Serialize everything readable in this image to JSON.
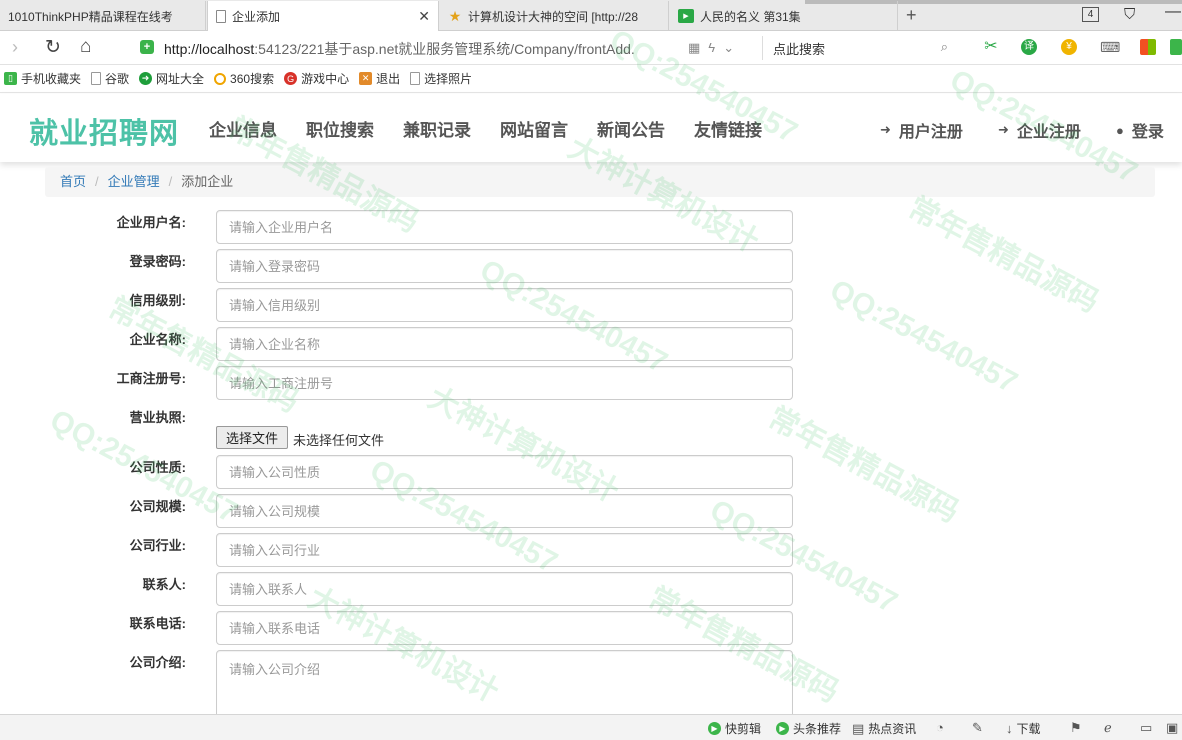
{
  "browser": {
    "tabs": [
      {
        "title": "1010ThinkPHP精品课程在线考",
        "icon": "page-icon"
      },
      {
        "title": "企业添加",
        "icon": "page-icon",
        "active": true
      },
      {
        "title": "计算机设计大神的空间 [http://28",
        "icon": "star-icon"
      },
      {
        "title": "人民的名义 第31集",
        "icon": "video-icon"
      }
    ],
    "tab_count": "4",
    "url_host": "http://localhost",
    "url_path": ":54123/221基于asp.net就业服务管理系统/Company/frontAdd.",
    "search_label": "点此搜索",
    "bookmarks": [
      "手机收藏夹",
      "谷歌",
      "网址大全",
      "360搜索",
      "游戏中心",
      "退出",
      "选择照片"
    ]
  },
  "site": {
    "logo": "就业招聘网",
    "nav": [
      "企业信息",
      "职位搜索",
      "兼职记录",
      "网站留言",
      "新闻公告",
      "友情链接"
    ],
    "user_register": "用户注册",
    "company_register": "企业注册",
    "login": "登录"
  },
  "breadcrumb": {
    "home": "首页",
    "section": "企业管理",
    "current": "添加企业"
  },
  "form": {
    "fields": [
      {
        "label": "企业用户名:",
        "placeholder": "请输入企业用户名"
      },
      {
        "label": "登录密码:",
        "placeholder": "请输入登录密码"
      },
      {
        "label": "信用级别:",
        "placeholder": "请输入信用级别"
      },
      {
        "label": "企业名称:",
        "placeholder": "请输入企业名称"
      },
      {
        "label": "工商注册号:",
        "placeholder": "请输入工商注册号"
      }
    ],
    "license_label": "营业执照:",
    "file_button": "选择文件",
    "file_status": "未选择任何文件",
    "fields2": [
      {
        "label": "公司性质:",
        "placeholder": "请输入公司性质"
      },
      {
        "label": "公司规模:",
        "placeholder": "请输入公司规模"
      },
      {
        "label": "公司行业:",
        "placeholder": "请输入公司行业"
      },
      {
        "label": "联系人:",
        "placeholder": "请输入联系人"
      },
      {
        "label": "联系电话:",
        "placeholder": "请输入联系电话"
      }
    ],
    "intro_label": "公司介绍:",
    "intro_placeholder": "请输入公司介绍"
  },
  "statusbar": {
    "items": [
      "快剪辑",
      "头条推荐",
      "热点资讯",
      "下载"
    ]
  },
  "watermark": {
    "qq": "QQ:254540457",
    "slogan1": "常年售精品源码",
    "slogan2": "大神计算机设计"
  }
}
